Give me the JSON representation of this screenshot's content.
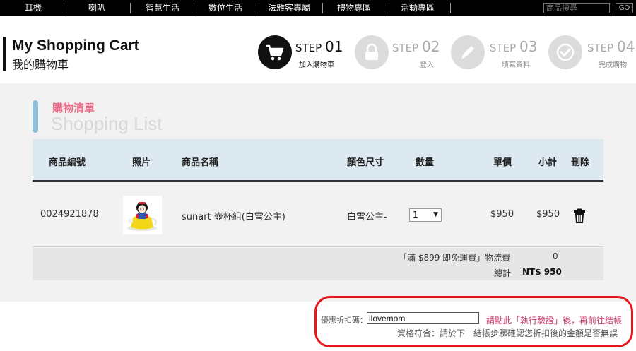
{
  "nav": {
    "items": [
      "耳機",
      "喇叭",
      "智慧生活",
      "數位生活",
      "法雅客專屬",
      "禮物專區",
      "活動專區"
    ],
    "search_placeholder": "商品搜尋",
    "go_label": "GO"
  },
  "header": {
    "title_en": "My Shopping Cart",
    "title_zh": "我的購物車"
  },
  "steps": [
    {
      "prefix": "STEP",
      "num": "01",
      "label": "加入購物車",
      "active": true,
      "icon": "cart-icon"
    },
    {
      "prefix": "STEP",
      "num": "02",
      "label": "登入",
      "active": false,
      "icon": "lock-icon"
    },
    {
      "prefix": "STEP",
      "num": "03",
      "label": "填寫資料",
      "active": false,
      "icon": "pencil-icon"
    },
    {
      "prefix": "STEP",
      "num": "04",
      "label": "完成購物",
      "active": false,
      "icon": "check-icon"
    }
  ],
  "list": {
    "title_zh": "購物清單",
    "title_en": "Shopping List"
  },
  "table": {
    "headers": {
      "id": "商品編號",
      "photo": "照片",
      "name": "商品名稱",
      "spec": "顏色尺寸",
      "qty": "數量",
      "price": "單價",
      "subtotal": "小計",
      "delete": "刪除"
    },
    "rows": [
      {
        "id": "0024921878",
        "name": "sunart 壺杯組(白雪公主)",
        "spec": "白雪公主-",
        "qty": "1",
        "price": "$950",
        "subtotal": "$950"
      }
    ]
  },
  "summary": {
    "shipping_label": "「滿 $899 即免運費」物流費",
    "shipping_value": "0",
    "total_label": "總計",
    "total_value": "NT$ 950"
  },
  "coupon": {
    "label": "優惠折扣碼：",
    "value": "ilovemom",
    "link": "請點此「執行驗證」後，再前往結帳",
    "note": "資格符合：請於下一結帳步驟確認您折扣後的金額是否無誤"
  },
  "colors": {
    "accent_pink": "#e86a87",
    "header_blue": "#dde9f1",
    "coupon_border": "#e8161b"
  }
}
